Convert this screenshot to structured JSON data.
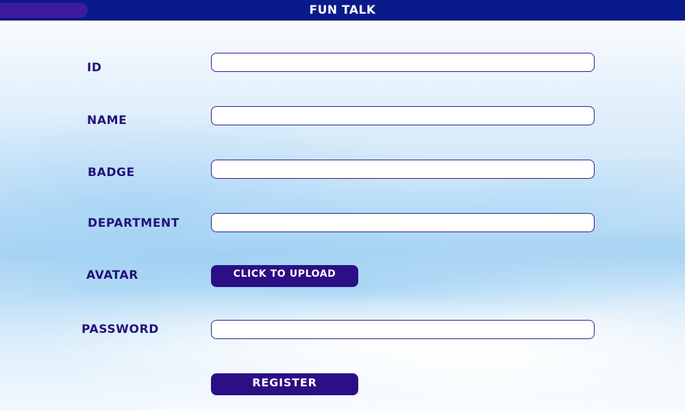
{
  "app": {
    "title": "FUN TALK"
  },
  "form": {
    "fields": [
      {
        "key": "id",
        "label": "ID",
        "value": "",
        "placeholder": ""
      },
      {
        "key": "name",
        "label": "NAME",
        "value": "",
        "placeholder": ""
      },
      {
        "key": "badge",
        "label": "BADGE",
        "value": "",
        "placeholder": ""
      },
      {
        "key": "department",
        "label": "DEPARTMENT",
        "value": "",
        "placeholder": ""
      },
      {
        "key": "avatar",
        "label": "AVATAR"
      },
      {
        "key": "password",
        "label": "PASSWORD",
        "value": "",
        "placeholder": ""
      }
    ],
    "upload_label": "CLICK TO UPLOAD",
    "register_label": "REGISTER"
  },
  "colors": {
    "titlebar": "#0b1a8a",
    "title_accent": "#3e1b9e",
    "label_text": "#24127a",
    "button": "#2b0f85",
    "input_border": "#2a1a8c"
  }
}
